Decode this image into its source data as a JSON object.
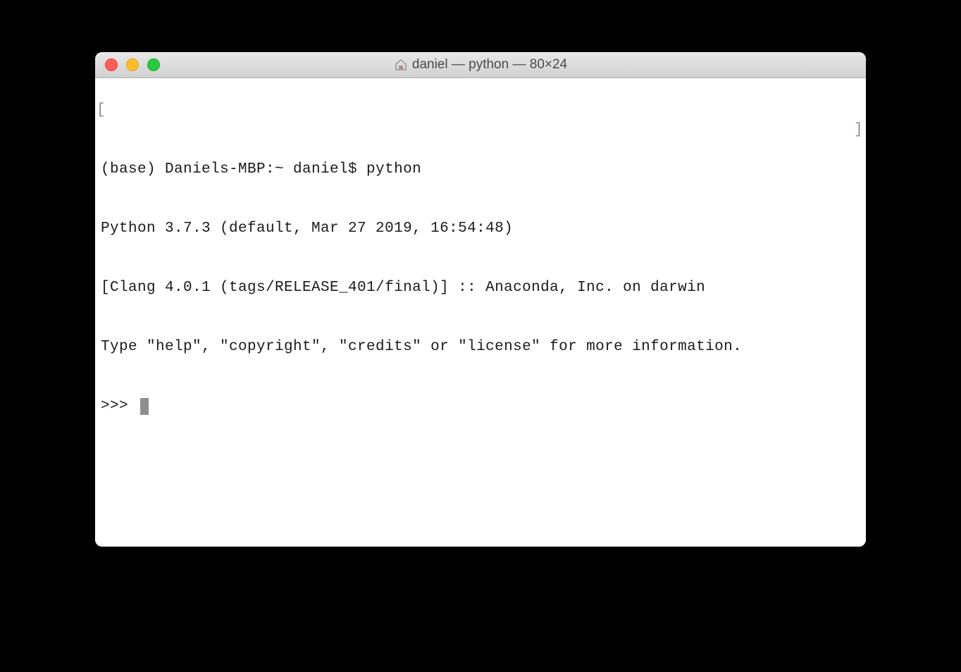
{
  "window": {
    "title": "daniel — python — 80×24"
  },
  "terminal": {
    "line1": "(base) Daniels-MBP:~ daniel$ python",
    "line2": "Python 3.7.3 (default, Mar 27 2019, 16:54:48) ",
    "line3": "[Clang 4.0.1 (tags/RELEASE_401/final)] :: Anaconda, Inc. on darwin",
    "line4": "Type \"help\", \"copyright\", \"credits\" or \"license\" for more information.",
    "prompt": ">>> "
  }
}
